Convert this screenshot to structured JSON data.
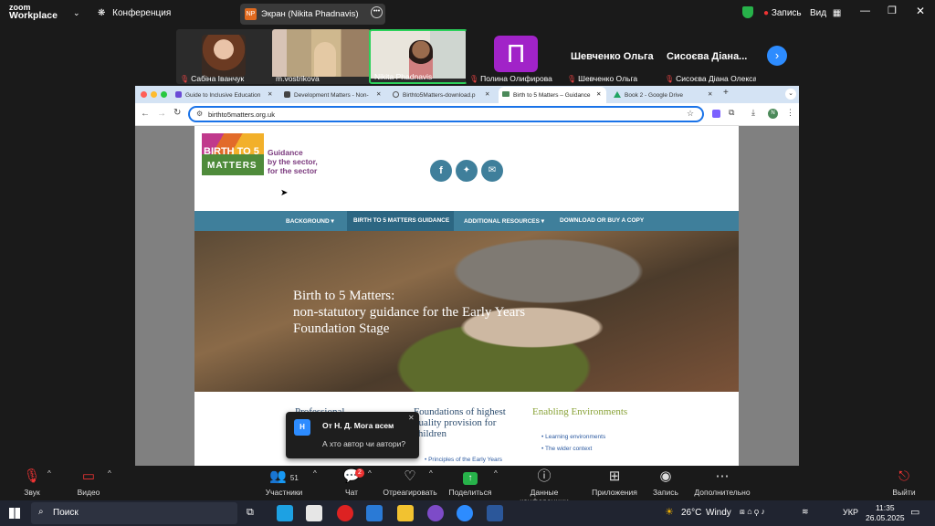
{
  "zoom": {
    "logo_line1": "zoom",
    "logo_line2": "Workplace",
    "meeting_menu": "Конференция",
    "share_badge": "NP",
    "share_title": "Экран (Nikita Phadnavis)",
    "record_label": "Запись",
    "view_label": "Вид",
    "participants": [
      {
        "name": "Сабіна Іванчук"
      },
      {
        "name": "m.vostrikova"
      },
      {
        "name": "Nikita Phadnavis"
      },
      {
        "name": "Полина Олифирова",
        "avatar_letter": "П"
      },
      {
        "name": "Шевченко Ольга",
        "big_name": "Шевченко Ольга"
      },
      {
        "name": "Сисоєва Діана Олекса...",
        "big_name": "Сисоєва Діана..."
      }
    ],
    "controls": {
      "audio": "Звук",
      "video": "Видео",
      "participants": "Участники",
      "participants_count": "51",
      "chat": "Чат",
      "chat_badge": "2",
      "react": "Отреагировать",
      "share": "Поделиться",
      "info": "Данные конференции",
      "apps": "Приложения",
      "record": "Запись",
      "more": "Дополнительно",
      "leave": "Выйти"
    },
    "notification": {
      "avatar": "Н",
      "title": "От Н. Д. Мога всем",
      "message": "А хто автор чи автори?"
    }
  },
  "browser": {
    "tabs": [
      {
        "label": "Guide to Inclusive Education"
      },
      {
        "label": "Development Matters - Non-"
      },
      {
        "label": "Birthto5Matters-download.p"
      },
      {
        "label": "Birth to 5 Matters – Guidance"
      },
      {
        "label": "Book 2 - Google Drive"
      }
    ],
    "url": "birthto5matters.org.uk",
    "profile_letter": "N"
  },
  "site": {
    "logo_line1": "BIRTH TO 5",
    "logo_line2": "MATTERS",
    "tagline1": "Guidance",
    "tagline2": "by the sector,",
    "tagline3": "for the sector",
    "nav": [
      "BACKGROUND ▾",
      "BIRTH TO 5 MATTERS GUIDANCE",
      "ADDITIONAL RESOURCES ▾",
      "DOWNLOAD OR BUY A COPY"
    ],
    "hero_line1": "Birth to 5 Matters:",
    "hero_line2": "non-statutory guidance for the Early Years",
    "hero_line3": "Foundation Stage",
    "col1_heading": "Professional",
    "col2_heading": "Foundations of highest quality provision for children",
    "col2_item1": "Principles of the Early Years",
    "col3_heading": "Enabling Environments",
    "col3_items": [
      "Learning environments",
      "The wider context"
    ]
  },
  "taskbar": {
    "search": "Поиск",
    "weather": "26°C",
    "weather_text": "Windy",
    "lang": "УКР",
    "time": "11:35",
    "date": "26.05.2025"
  },
  "colors": {
    "nav_blue": "#3f7f9b",
    "nav_active": "#2c6682",
    "green_heading": "#8aa339",
    "purple_tagline": "#7b3a7e",
    "zoom_blue": "#2d8cff"
  }
}
